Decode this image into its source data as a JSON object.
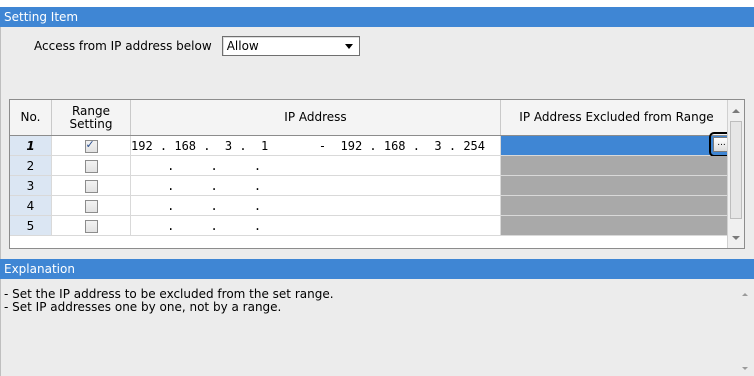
{
  "setting_header": "Setting Item",
  "access": {
    "label": "Access from IP address below",
    "selected": "Allow"
  },
  "grid": {
    "columns": {
      "no": "No.",
      "range_line1": "Range",
      "range_line2": "Setting",
      "ip": "IP Address",
      "excluded": "IP Address Excluded from Range"
    },
    "rows": [
      {
        "no": "1",
        "checked": true,
        "ip": "192 . 168 .  3 .  1       -  192 . 168 .  3 . 254"
      },
      {
        "no": "2",
        "checked": false,
        "ip": "     .     .     ."
      },
      {
        "no": "3",
        "checked": false,
        "ip": "     .     .     ."
      },
      {
        "no": "4",
        "checked": false,
        "ip": "     .     .     ."
      },
      {
        "no": "5",
        "checked": false,
        "ip": "     .     .     ."
      }
    ],
    "ellipsis_label": "..."
  },
  "explanation_header": "Explanation",
  "explanation_lines": [
    "- Set the IP address to be excluded from the set range.",
    "- Set IP addresses one by one, not by a range."
  ],
  "colors": {
    "header_bg": "#3f86d4",
    "row_number_bg": "#dbe6f3",
    "disabled_cell": "#a9a9a9"
  }
}
